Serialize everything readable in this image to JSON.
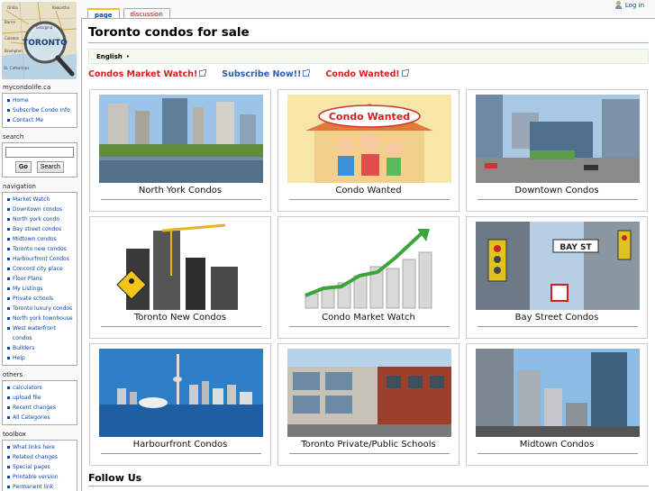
{
  "topbar": {
    "login_label": "Log in",
    "tabs": [
      {
        "label": "page",
        "active": true
      },
      {
        "label": "discussion",
        "active": false
      }
    ]
  },
  "logo": {
    "city_label": "TORONTO",
    "places": [
      "Orillia",
      "Kawartha",
      "Peterborough",
      "Georgina",
      "Barrie",
      "Oshawa",
      "Caledon",
      "Cobourg",
      "Hamilton",
      "Brampton",
      "Lake Ontario",
      "St. Catharines"
    ]
  },
  "sidebar": {
    "site": {
      "heading": "mycondolife.ca",
      "items": [
        "Home",
        "Subscribe Condo Info",
        "Contact Me"
      ]
    },
    "search": {
      "heading": "search",
      "placeholder": "",
      "go_label": "Go",
      "search_label": "Search"
    },
    "navigation": {
      "heading": "navigation",
      "items": [
        "Market Watch",
        "Downtown condos",
        "North york condo",
        "Bay street condos",
        "Midtown condos",
        "Toronto new condos",
        "Harbourfront Condos",
        "Concord city place",
        "Floor Plans",
        "My Listings",
        "Private schools",
        "Toronto luxury condos",
        "North york townhouse",
        "West waterfront condos",
        "Builders",
        "Help"
      ]
    },
    "others": {
      "heading": "others",
      "items": [
        "calculators",
        "upload file",
        "Recent changes",
        "All Categories"
      ]
    },
    "toolbox": {
      "heading": "toolbox",
      "items": [
        "What links here",
        "Related changes",
        "Special pages",
        "Printable version",
        "Permanent link"
      ]
    }
  },
  "main": {
    "title": "Toronto condos for sale",
    "language": "English",
    "language_sep": "•",
    "promos": [
      {
        "label": "Condos Market Watch!",
        "color": "#d81e1e"
      },
      {
        "label": "Subscribe Now!!",
        "color": "#2a5db0"
      },
      {
        "label": "Condo Wanted!",
        "color": "#d81e1e"
      }
    ],
    "cards": [
      {
        "label": "North York Condos",
        "image": "north-york-towers"
      },
      {
        "label": "Condo Wanted",
        "image": "condo-wanted-cartoon",
        "sign_text": "Condo Wanted"
      },
      {
        "label": "Downtown Condos",
        "image": "downtown-street"
      },
      {
        "label": "Toronto New Condos",
        "image": "crane-construction"
      },
      {
        "label": "Condo Market Watch",
        "image": "growth-bar-chart"
      },
      {
        "label": "Bay Street Condos",
        "image": "bay-street-sign",
        "sign_text": "BAY ST"
      },
      {
        "label": "Harbourfront Condos",
        "image": "skyline-cn-tower"
      },
      {
        "label": "Toronto Private/Public Schools",
        "image": "school-building"
      },
      {
        "label": "Midtown Condos",
        "image": "midtown-towers"
      }
    ],
    "follow_heading": "Follow Us"
  },
  "colors": {
    "link": "#0645ad",
    "promo_red": "#d81e1e",
    "promo_blue": "#2a5db0",
    "lang_box": "#f5faee"
  }
}
